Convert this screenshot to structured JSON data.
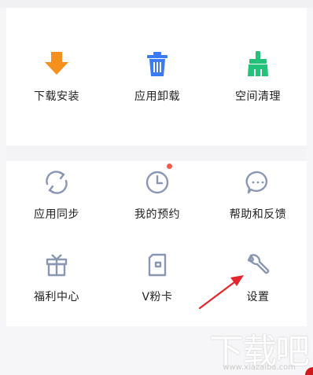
{
  "grid": {
    "row1": [
      {
        "label": "下载安装",
        "icon": "download-arrow-icon"
      },
      {
        "label": "应用卸载",
        "icon": "trash-can-icon"
      },
      {
        "label": "空间清理",
        "icon": "broom-icon"
      }
    ],
    "row2": [
      {
        "label": "应用同步",
        "icon": "sync-icon"
      },
      {
        "label": "我的预约",
        "icon": "clock-icon"
      },
      {
        "label": "帮助和反馈",
        "icon": "chat-bubble-icon"
      }
    ],
    "row3": [
      {
        "label": "福利中心",
        "icon": "gift-icon"
      },
      {
        "label": "V粉卡",
        "icon": "card-icon"
      },
      {
        "label": "设置",
        "icon": "wrench-icon"
      }
    ]
  },
  "colors": {
    "download": "#f5901e",
    "trash": "#3a7af3",
    "broom": "#22c27a",
    "outline": "#8a97b3",
    "badge": "#f25c4d",
    "arrow": "#e3262b"
  },
  "watermark": {
    "text": "下载吧",
    "sub": "www.xiazaiba.com"
  }
}
